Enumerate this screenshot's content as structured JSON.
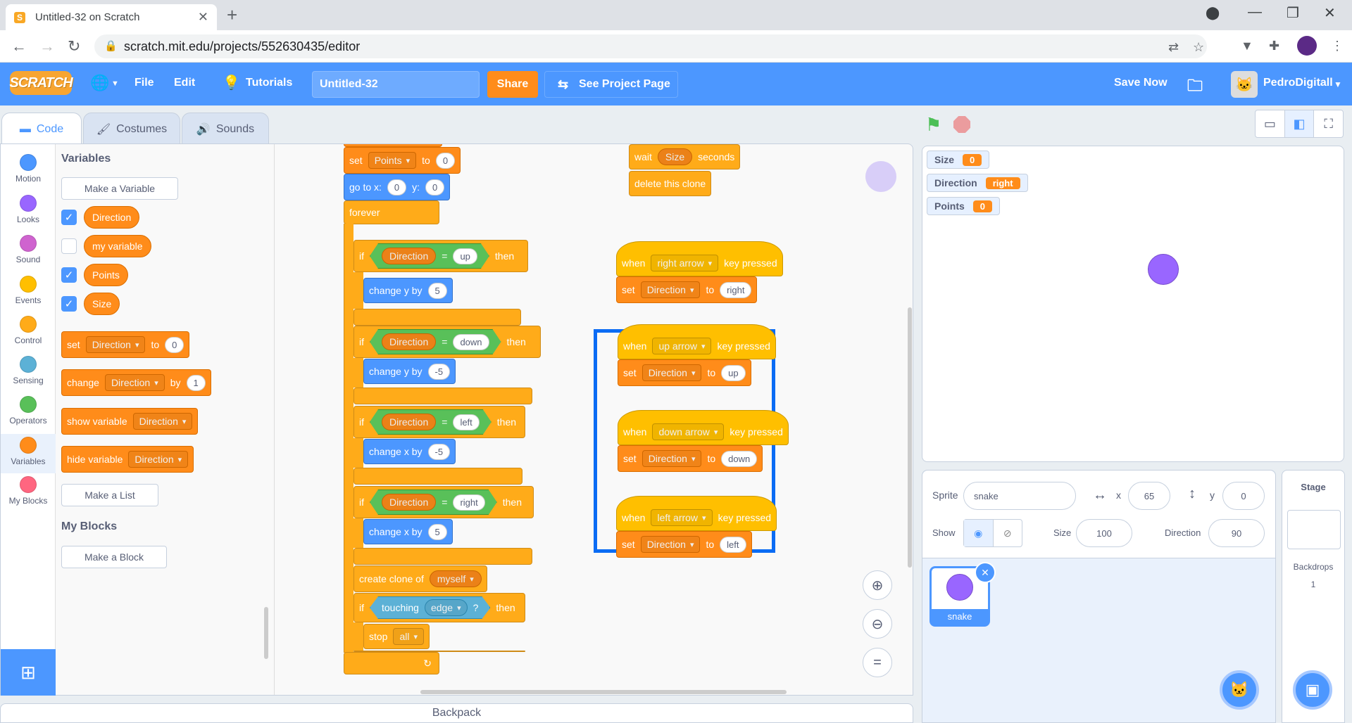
{
  "browser": {
    "tab_title": "Untitled-32 on Scratch",
    "url": "scratch.mit.edu/projects/552630435/editor"
  },
  "menubar": {
    "logo": "SCRATCH",
    "file": "File",
    "edit": "Edit",
    "tutorials": "Tutorials",
    "project_title": "Untitled-32",
    "share": "Share",
    "see_project_page": "See Project Page",
    "save_now": "Save Now",
    "username": "PedroDigitall"
  },
  "editor_tabs": {
    "code": "Code",
    "costumes": "Costumes",
    "sounds": "Sounds"
  },
  "categories": [
    "Motion",
    "Looks",
    "Sound",
    "Events",
    "Control",
    "Sensing",
    "Operators",
    "Variables",
    "My Blocks"
  ],
  "category_colors": {
    "Motion": "#4c97ff",
    "Looks": "#9966ff",
    "Sound": "#cf63cf",
    "Events": "#ffbf00",
    "Control": "#ffab19",
    "Sensing": "#5cb1d6",
    "Operators": "#59c059",
    "Variables": "#ff8c1a",
    "My Blocks": "#ff6680"
  },
  "palette": {
    "variables_heading": "Variables",
    "make_variable": "Make a Variable",
    "variables": [
      {
        "name": "Direction",
        "checked": true
      },
      {
        "name": "my variable",
        "checked": false
      },
      {
        "name": "Points",
        "checked": true
      },
      {
        "name": "Size",
        "checked": true
      }
    ],
    "set_block": {
      "label": "set",
      "var": "Direction",
      "to": "to",
      "value": "0"
    },
    "change_block": {
      "label": "change",
      "var": "Direction",
      "by": "by",
      "value": "1"
    },
    "show_block": {
      "label": "show variable",
      "var": "Direction"
    },
    "hide_block": {
      "label": "hide variable",
      "var": "Direction"
    },
    "make_list": "Make a List",
    "myblocks_heading": "My Blocks",
    "make_block": "Make a Block"
  },
  "script_main": {
    "set": "set",
    "set_var": "Points",
    "to": "to",
    "set_val": "0",
    "goto": "go to x:",
    "goto_x": "0",
    "y_label": "y:",
    "goto_y": "0",
    "forever": "forever",
    "if": "if",
    "then": "then",
    "dir": "Direction",
    "eq": "=",
    "c1": "up",
    "c2": "down",
    "c3": "left",
    "c4": "right",
    "change_y": "change y by",
    "change_x": "change x by",
    "v1": "5",
    "v2": "-5",
    "v3": "-5",
    "v4": "5",
    "create_clone": "create clone of",
    "clone_target": "myself",
    "touching": "touching",
    "edge": "edge",
    "q": "?",
    "stop": "stop",
    "stop_opt": "all"
  },
  "script_clone": {
    "wait": "wait",
    "size": "Size",
    "seconds": "seconds",
    "delete": "delete this clone"
  },
  "key_scripts": {
    "when": "when",
    "key_pressed": "key pressed",
    "set": "set",
    "var": "Direction",
    "to": "to",
    "right_key": "right arrow",
    "right_val": "right",
    "up_key": "up arrow",
    "up_val": "up",
    "down_key": "down arrow",
    "down_val": "down",
    "left_key": "left arrow",
    "left_val": "left"
  },
  "stage_monitors": [
    {
      "name": "Size",
      "value": "0"
    },
    {
      "name": "Direction",
      "value": "right"
    },
    {
      "name": "Points",
      "value": "0"
    }
  ],
  "sprite_info": {
    "sprite_label": "Sprite",
    "sprite_name": "snake",
    "x_label": "x",
    "x": "65",
    "y_label": "y",
    "y": "0",
    "show_label": "Show",
    "size_label": "Size",
    "size": "100",
    "direction_label": "Direction",
    "direction": "90"
  },
  "sprite_thumb": "snake",
  "stage_pane": {
    "title": "Stage",
    "backdrops_label": "Backdrops",
    "backdrops_count": "1"
  },
  "backpack": "Backpack"
}
